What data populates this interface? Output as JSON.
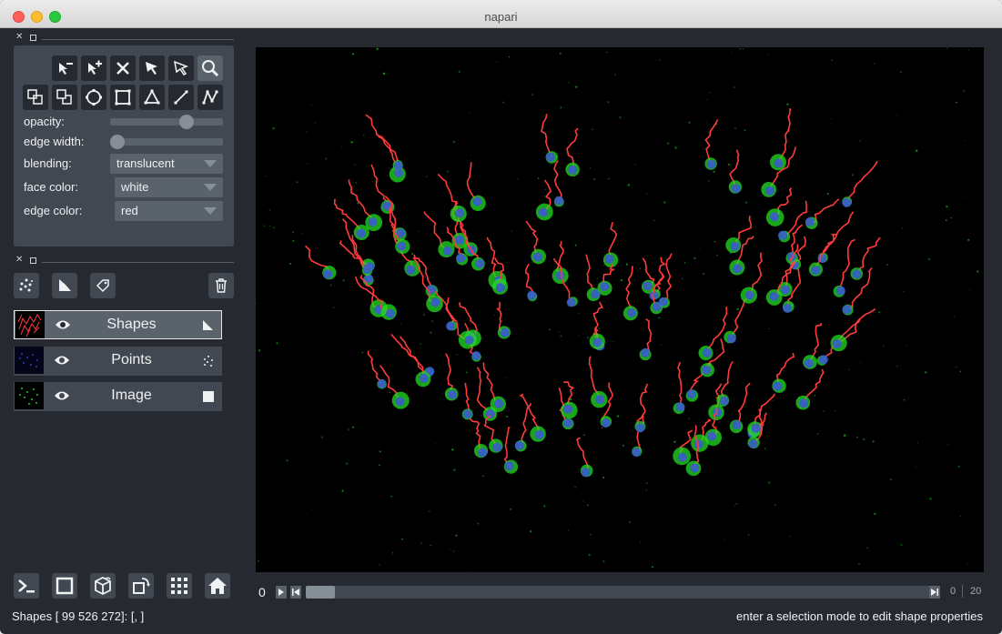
{
  "window": {
    "title": "napari"
  },
  "controls": {
    "opacity_label": "opacity:",
    "opacity_value": 0.7,
    "edge_width_label": "edge width:",
    "edge_width_value": 0.0,
    "blending_label": "blending:",
    "blending_value": "translucent",
    "face_color_label": "face color:",
    "face_color_value": "white",
    "edge_color_label": "edge color:",
    "edge_color_value": "red",
    "tools_row1": [
      "remove-vertex-icon",
      "add-vertex-icon",
      "delete-shape-icon",
      "select-icon",
      "direct-select-icon",
      "pan-zoom-icon"
    ],
    "tools_row2": [
      "move-back-icon",
      "move-front-icon",
      "ellipse-icon",
      "rectangle-icon",
      "polygon-icon",
      "line-icon",
      "path-icon"
    ],
    "active_tool": "pan-zoom-icon"
  },
  "layer_buttons": [
    "new-points-icon",
    "new-shapes-icon",
    "new-labels-icon",
    "delete-layer-icon"
  ],
  "layers": [
    {
      "name": "Shapes",
      "type_icon": "shapes-icon",
      "visible": true,
      "selected": true
    },
    {
      "name": "Points",
      "type_icon": "points-icon",
      "visible": true,
      "selected": false
    },
    {
      "name": "Image",
      "type_icon": "image-icon",
      "visible": true,
      "selected": false
    }
  ],
  "bottom_buttons": [
    "console-icon",
    "ndisplay-square-icon",
    "3d-cube-icon",
    "roll-icon",
    "grid-icon",
    "home-icon"
  ],
  "dims": {
    "current": "0",
    "slider_position": 0,
    "current_small": "0",
    "max": "20"
  },
  "status": {
    "left": "Shapes [ 99 526 272]: [, ]",
    "right": "enter a selection mode to edit shape properties"
  },
  "colors": {
    "background": "#262930",
    "panel": "#414851",
    "track": "#5a626c",
    "accent": "#868e98",
    "edge": "#ff3b3b",
    "nucleus": "#3b5bcc",
    "cell": "#22dd22"
  }
}
